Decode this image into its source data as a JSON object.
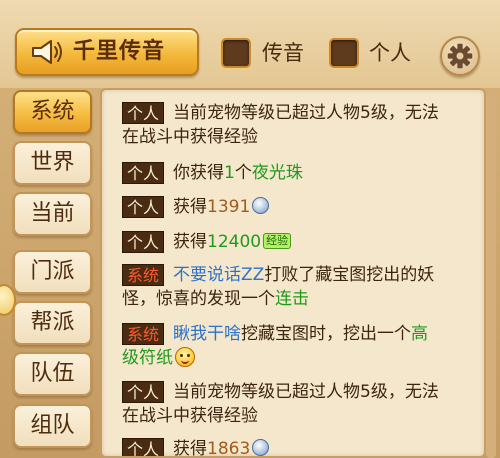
{
  "header": {
    "broadcast_label": "千里传音",
    "channel_whisper_label": "传音",
    "channel_personal_label": "个人"
  },
  "sidebar": {
    "tabs": [
      {
        "label": "系统",
        "active": true
      },
      {
        "label": "世界",
        "active": false
      },
      {
        "label": "当前",
        "active": false
      },
      {
        "label": "门派",
        "active": false
      },
      {
        "label": "帮派",
        "active": false
      },
      {
        "label": "队伍",
        "active": false
      },
      {
        "label": "组队",
        "active": false
      }
    ]
  },
  "messages": [
    {
      "tag": "个人",
      "tag_type": "personal",
      "line1": [
        {
          "text": "当前宠物等级已超过人物5级，无法"
        }
      ],
      "line2": [
        {
          "text": "在战斗中获得经验"
        }
      ]
    },
    {
      "tag": "个人",
      "tag_type": "personal",
      "line1": [
        {
          "text": "你获得"
        },
        {
          "text": "1",
          "style": "t-green"
        },
        {
          "text": "个"
        },
        {
          "text": "夜光珠",
          "style": "t-green"
        }
      ]
    },
    {
      "tag": "个人",
      "tag_type": "personal",
      "line1": [
        {
          "text": "获得"
        },
        {
          "text": "1391",
          "style": "t-num"
        },
        {
          "icon": "silver-coin-icon"
        }
      ]
    },
    {
      "tag": "个人",
      "tag_type": "personal",
      "line1": [
        {
          "text": "获得"
        },
        {
          "text": "12400",
          "style": "t-green"
        },
        {
          "icon": "experience-icon",
          "text": "经验"
        }
      ]
    },
    {
      "tag": "系统",
      "tag_type": "system",
      "line1": [
        {
          "text": "不要说话ZZ",
          "style": "t-blue"
        },
        {
          "text": "打败了藏宝图挖出的妖"
        }
      ],
      "line2": [
        {
          "text": "怪，惊喜的发现一个"
        },
        {
          "text": "连击",
          "style": "t-green"
        }
      ]
    },
    {
      "tag": "系统",
      "tag_type": "system",
      "line1": [
        {
          "text": "瞅我干啥",
          "style": "t-blue"
        },
        {
          "text": "挖藏宝图时，挖出一个"
        },
        {
          "text": "高",
          "style": "t-green"
        }
      ],
      "line2": [
        {
          "text": "级符纸",
          "style": "t-green"
        },
        {
          "icon": "smile-emoji-icon"
        }
      ]
    },
    {
      "tag": "个人",
      "tag_type": "personal",
      "line1": [
        {
          "text": "当前宠物等级已超过人物5级，无法"
        }
      ],
      "line2": [
        {
          "text": "在战斗中获得经验"
        }
      ]
    },
    {
      "tag": "个人",
      "tag_type": "personal",
      "line1": [
        {
          "text": "获得"
        },
        {
          "text": "1863",
          "style": "t-num"
        },
        {
          "icon": "silver-coin-icon"
        }
      ]
    }
  ]
}
